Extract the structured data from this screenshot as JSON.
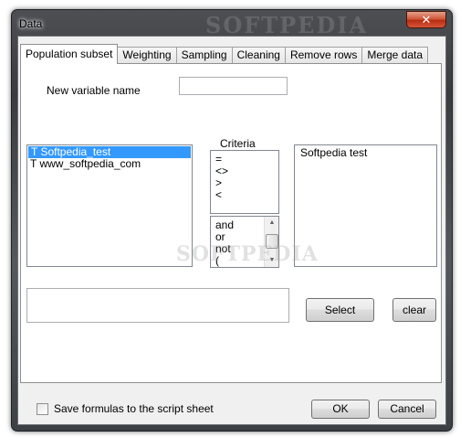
{
  "window": {
    "title": "Data",
    "watermark": "SOFTPEDIA",
    "close_glyph": "✕"
  },
  "tabs": [
    {
      "label": "Population subset",
      "active": true
    },
    {
      "label": "Weighting"
    },
    {
      "label": "Sampling"
    },
    {
      "label": "Cleaning"
    },
    {
      "label": "Remove rows"
    },
    {
      "label": "Merge data"
    }
  ],
  "form": {
    "new_variable_label": "New variable name",
    "new_variable_value": "",
    "criteria_label": "Criteria"
  },
  "variables": [
    {
      "text": "T Softpedia_test",
      "selected": true
    },
    {
      "text": "T www_softpedia_com"
    }
  ],
  "criteria_ops": [
    "=",
    "<>",
    ">",
    "<"
  ],
  "logic_ops": [
    "and",
    "or",
    "not",
    "("
  ],
  "result_text": "Softpedia test",
  "formula_value": "",
  "center_watermark": "SOFTPEDIA",
  "buttons": {
    "select": "Select",
    "clear": "clear",
    "ok": "OK",
    "cancel": "Cancel"
  },
  "save_formulas_label": "Save formulas to the script sheet",
  "icons": {
    "close": "close-icon",
    "scroll_up": "chevron-up-icon",
    "scroll_down": "chevron-down-icon"
  }
}
